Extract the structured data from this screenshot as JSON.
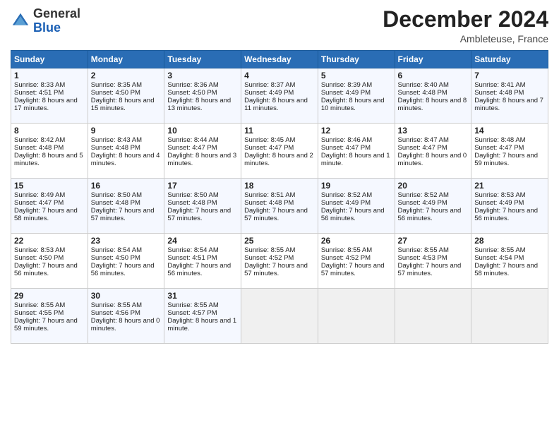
{
  "header": {
    "logo_line1": "General",
    "logo_line2": "Blue",
    "month_year": "December 2024",
    "location": "Ambleteuse, France"
  },
  "days_of_week": [
    "Sunday",
    "Monday",
    "Tuesday",
    "Wednesday",
    "Thursday",
    "Friday",
    "Saturday"
  ],
  "weeks": [
    [
      {
        "day": "1",
        "sunrise": "8:33 AM",
        "sunset": "4:51 PM",
        "daylight": "8 hours and 17 minutes."
      },
      {
        "day": "2",
        "sunrise": "8:35 AM",
        "sunset": "4:50 PM",
        "daylight": "8 hours and 15 minutes."
      },
      {
        "day": "3",
        "sunrise": "8:36 AM",
        "sunset": "4:50 PM",
        "daylight": "8 hours and 13 minutes."
      },
      {
        "day": "4",
        "sunrise": "8:37 AM",
        "sunset": "4:49 PM",
        "daylight": "8 hours and 11 minutes."
      },
      {
        "day": "5",
        "sunrise": "8:39 AM",
        "sunset": "4:49 PM",
        "daylight": "8 hours and 10 minutes."
      },
      {
        "day": "6",
        "sunrise": "8:40 AM",
        "sunset": "4:48 PM",
        "daylight": "8 hours and 8 minutes."
      },
      {
        "day": "7",
        "sunrise": "8:41 AM",
        "sunset": "4:48 PM",
        "daylight": "8 hours and 7 minutes."
      }
    ],
    [
      {
        "day": "8",
        "sunrise": "8:42 AM",
        "sunset": "4:48 PM",
        "daylight": "8 hours and 5 minutes."
      },
      {
        "day": "9",
        "sunrise": "8:43 AM",
        "sunset": "4:48 PM",
        "daylight": "8 hours and 4 minutes."
      },
      {
        "day": "10",
        "sunrise": "8:44 AM",
        "sunset": "4:47 PM",
        "daylight": "8 hours and 3 minutes."
      },
      {
        "day": "11",
        "sunrise": "8:45 AM",
        "sunset": "4:47 PM",
        "daylight": "8 hours and 2 minutes."
      },
      {
        "day": "12",
        "sunrise": "8:46 AM",
        "sunset": "4:47 PM",
        "daylight": "8 hours and 1 minute."
      },
      {
        "day": "13",
        "sunrise": "8:47 AM",
        "sunset": "4:47 PM",
        "daylight": "8 hours and 0 minutes."
      },
      {
        "day": "14",
        "sunrise": "8:48 AM",
        "sunset": "4:47 PM",
        "daylight": "7 hours and 59 minutes."
      }
    ],
    [
      {
        "day": "15",
        "sunrise": "8:49 AM",
        "sunset": "4:47 PM",
        "daylight": "7 hours and 58 minutes."
      },
      {
        "day": "16",
        "sunrise": "8:50 AM",
        "sunset": "4:48 PM",
        "daylight": "7 hours and 57 minutes."
      },
      {
        "day": "17",
        "sunrise": "8:50 AM",
        "sunset": "4:48 PM",
        "daylight": "7 hours and 57 minutes."
      },
      {
        "day": "18",
        "sunrise": "8:51 AM",
        "sunset": "4:48 PM",
        "daylight": "7 hours and 57 minutes."
      },
      {
        "day": "19",
        "sunrise": "8:52 AM",
        "sunset": "4:49 PM",
        "daylight": "7 hours and 56 minutes."
      },
      {
        "day": "20",
        "sunrise": "8:52 AM",
        "sunset": "4:49 PM",
        "daylight": "7 hours and 56 minutes."
      },
      {
        "day": "21",
        "sunrise": "8:53 AM",
        "sunset": "4:49 PM",
        "daylight": "7 hours and 56 minutes."
      }
    ],
    [
      {
        "day": "22",
        "sunrise": "8:53 AM",
        "sunset": "4:50 PM",
        "daylight": "7 hours and 56 minutes."
      },
      {
        "day": "23",
        "sunrise": "8:54 AM",
        "sunset": "4:50 PM",
        "daylight": "7 hours and 56 minutes."
      },
      {
        "day": "24",
        "sunrise": "8:54 AM",
        "sunset": "4:51 PM",
        "daylight": "7 hours and 56 minutes."
      },
      {
        "day": "25",
        "sunrise": "8:55 AM",
        "sunset": "4:52 PM",
        "daylight": "7 hours and 57 minutes."
      },
      {
        "day": "26",
        "sunrise": "8:55 AM",
        "sunset": "4:52 PM",
        "daylight": "7 hours and 57 minutes."
      },
      {
        "day": "27",
        "sunrise": "8:55 AM",
        "sunset": "4:53 PM",
        "daylight": "7 hours and 57 minutes."
      },
      {
        "day": "28",
        "sunrise": "8:55 AM",
        "sunset": "4:54 PM",
        "daylight": "7 hours and 58 minutes."
      }
    ],
    [
      {
        "day": "29",
        "sunrise": "8:55 AM",
        "sunset": "4:55 PM",
        "daylight": "7 hours and 59 minutes."
      },
      {
        "day": "30",
        "sunrise": "8:55 AM",
        "sunset": "4:56 PM",
        "daylight": "8 hours and 0 minutes."
      },
      {
        "day": "31",
        "sunrise": "8:55 AM",
        "sunset": "4:57 PM",
        "daylight": "8 hours and 1 minute."
      },
      null,
      null,
      null,
      null
    ]
  ]
}
